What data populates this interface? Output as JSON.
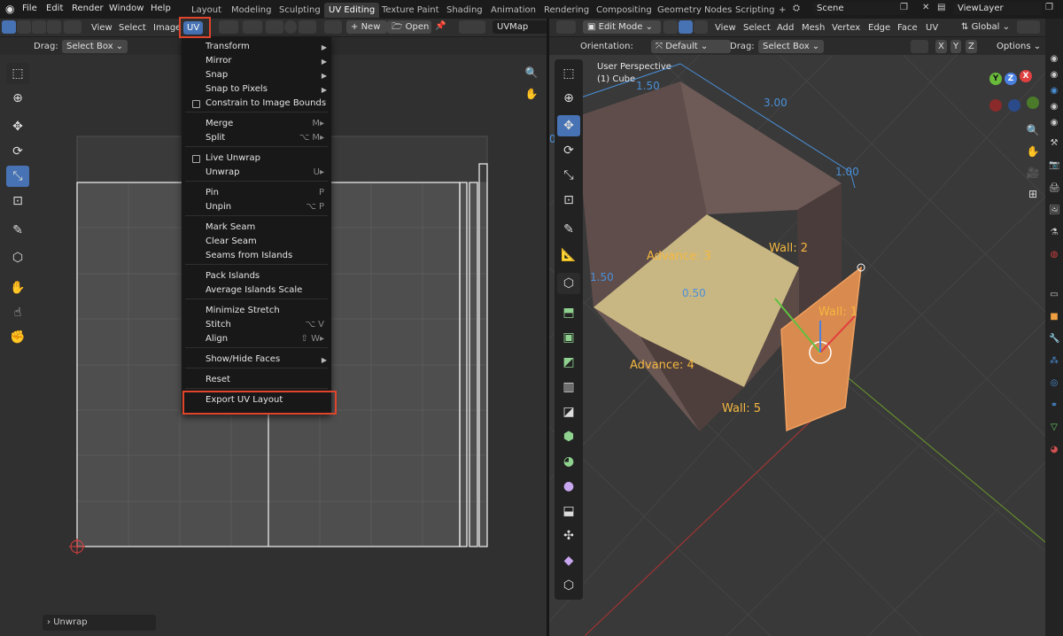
{
  "topbar": {
    "menus": [
      "File",
      "Edit",
      "Render",
      "Window",
      "Help"
    ],
    "workspaces": [
      "Layout",
      "Modeling",
      "Sculpting",
      "UV Editing",
      "Texture Paint",
      "Shading",
      "Animation",
      "Rendering",
      "Compositing",
      "Geometry Nodes",
      "Scripting"
    ],
    "active_workspace": "UV Editing",
    "add_workspace": "+",
    "scene": "Scene",
    "view_layer": "ViewLayer"
  },
  "uv_editor": {
    "menus": [
      "View",
      "Select",
      "Image",
      "UV"
    ],
    "active_menu": "UV",
    "new_label": "New",
    "open_label": "Open",
    "uv_map": "UVMap",
    "drag_label": "Drag:",
    "drag_value": "Select Box",
    "unwrap_panel": "Unwrap"
  },
  "uv_menu": {
    "groups": [
      [
        {
          "label": "Transform",
          "sub": true
        },
        {
          "label": "Mirror",
          "sub": true
        },
        {
          "label": "Snap",
          "sub": true
        },
        {
          "label": "Snap to Pixels",
          "sub": true
        },
        {
          "label": "Constrain to Image Bounds",
          "check": true
        }
      ],
      [
        {
          "label": "Merge",
          "shortcut": "M▸"
        },
        {
          "label": "Split",
          "shortcut": "⌥ M▸"
        }
      ],
      [
        {
          "label": "Live Unwrap",
          "check": true
        },
        {
          "label": "Unwrap",
          "shortcut": "U▸"
        }
      ],
      [
        {
          "label": "Pin",
          "shortcut": "P"
        },
        {
          "label": "Unpin",
          "shortcut": "⌥ P"
        }
      ],
      [
        {
          "label": "Mark Seam"
        },
        {
          "label": "Clear Seam"
        },
        {
          "label": "Seams from Islands"
        }
      ],
      [
        {
          "label": "Pack Islands"
        },
        {
          "label": "Average Islands Scale"
        }
      ],
      [
        {
          "label": "Minimize Stretch"
        },
        {
          "label": "Stitch",
          "shortcut": "⌥ V"
        },
        {
          "label": "Align",
          "shortcut": "⇧ W▸"
        }
      ],
      [
        {
          "label": "Show/Hide Faces",
          "sub": true
        }
      ],
      [
        {
          "label": "Reset"
        }
      ],
      [
        {
          "label": "Export UV Layout"
        }
      ]
    ],
    "highlighted": "Export UV Layout"
  },
  "viewport": {
    "mode": "Edit Mode",
    "menus": [
      "View",
      "Select",
      "Add",
      "Mesh",
      "Vertex",
      "Edge",
      "Face",
      "UV"
    ],
    "transform_orientation": "Global",
    "orientation_label": "Orientation:",
    "orientation_value": "Default",
    "drag_label": "Drag:",
    "drag_value": "Select Box",
    "axes": [
      "X",
      "Y",
      "Z"
    ],
    "options_label": "Options",
    "perspective_label": "User Perspective",
    "object_label": "(1) Cube",
    "dimensions": [
      "1.50",
      "3.00",
      "1.00",
      "1.50",
      "0.50",
      "0"
    ],
    "annotations": [
      "Advance: 3",
      "Wall: 2",
      "Wall: 1",
      "Advance: 4",
      "Wall: 5"
    ],
    "gizmo": {
      "x": "X",
      "y": "Y",
      "z": "Z"
    }
  },
  "colors": {
    "accent": "#4772b3",
    "highlight": "#e0452c",
    "annotation": "#f5b840",
    "dimension": "#4a90d9",
    "floor": "#c9b783",
    "wall": "#7a6460",
    "selected_face": "#d98a4e"
  }
}
